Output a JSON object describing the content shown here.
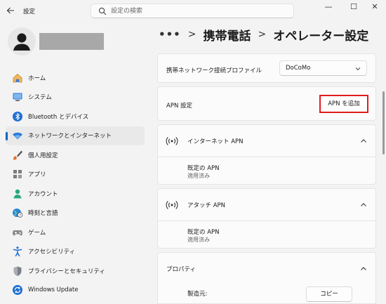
{
  "titlebar": {
    "app_title": "設定",
    "search_placeholder": "設定の検索",
    "minimize": "—",
    "maximize": "☐",
    "close": "✕"
  },
  "user": {
    "name": ""
  },
  "sidebar": {
    "items": [
      {
        "label": "ホーム",
        "icon": "home-icon"
      },
      {
        "label": "システム",
        "icon": "system-monitor-icon"
      },
      {
        "label": "Bluetooth とデバイス",
        "icon": "bluetooth-icon"
      },
      {
        "label": "ネットワークとインターネット",
        "icon": "wifi-icon",
        "active": true
      },
      {
        "label": "個人用設定",
        "icon": "paintbrush-icon"
      },
      {
        "label": "アプリ",
        "icon": "apps-icon"
      },
      {
        "label": "アカウント",
        "icon": "account-icon"
      },
      {
        "label": "時刻と言語",
        "icon": "globe-clock-icon"
      },
      {
        "label": "ゲーム",
        "icon": "gamepad-icon"
      },
      {
        "label": "アクセシビリティ",
        "icon": "accessibility-icon"
      },
      {
        "label": "プライバシーとセキュリティ",
        "icon": "shield-icon"
      },
      {
        "label": "Windows Update",
        "icon": "windows-update-icon"
      }
    ]
  },
  "breadcrumb": {
    "more": "•••",
    "sep": ">",
    "level1": "携帯電話",
    "level2": "オペレーター設定"
  },
  "profile": {
    "label": "携帯ネットワーク接続プロファイル",
    "value": "DoCoMo"
  },
  "apn_settings": {
    "label": "APN 設定",
    "add_button": "APN を追加"
  },
  "internet_apn": {
    "title": "インターネット APN",
    "item_name": "既定の APN",
    "item_status": "適用済み"
  },
  "attach_apn": {
    "title": "アタッチ APN",
    "item_name": "既定の APN",
    "item_status": "適用済み"
  },
  "properties": {
    "title": "プロパティ",
    "manufacturer_label": "製造元:",
    "copy_button": "コピー"
  },
  "colors": {
    "accent": "#0067c0",
    "highlight_border": "#e01d1d"
  }
}
